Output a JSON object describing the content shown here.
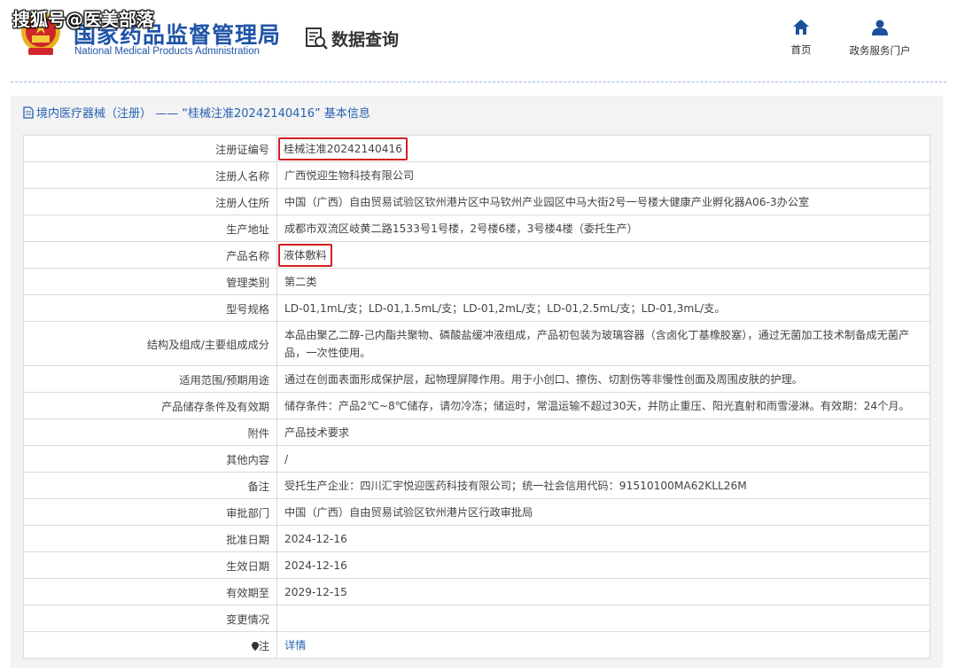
{
  "watermark": "搜狐号@医美部落",
  "header": {
    "org_name_cn": "国家药品监督管理局",
    "org_name_en": "National Medical Products Administration",
    "query_label": "数据查询",
    "nav": {
      "home_label": "首页",
      "gov_portal_label": "政务服务门户"
    }
  },
  "breadcrumb": {
    "text": "境内医疗器械（注册） —— “桂械注准20242140416” 基本信息"
  },
  "record": {
    "rows": [
      {
        "label": "注册证编号",
        "value": "桂械注准20242140416"
      },
      {
        "label": "注册人名称",
        "value": "广西悦迎生物科技有限公司"
      },
      {
        "label": "注册人住所",
        "value": "中国（广西）自由贸易试验区钦州港片区中马钦州产业园区中马大街2号一号楼大健康产业孵化器A06-3办公室"
      },
      {
        "label": "生产地址",
        "value": "成都市双流区岐黄二路1533号1号楼，2号楼6楼，3号楼4楼（委托生产）"
      },
      {
        "label": "产品名称",
        "value": "液体敷料"
      },
      {
        "label": "管理类别",
        "value": "第二类"
      },
      {
        "label": "型号规格",
        "value": "LD-01,1mL/支；LD-01,1.5mL/支；LD-01,2mL/支；LD-01,2.5mL/支；LD-01,3mL/支。"
      },
      {
        "label": "结构及组成/主要组成成分",
        "value": "本品由聚乙二醇-己内酯共聚物、磷酸盐缓冲液组成，产品初包装为玻璃容器（含卤化丁基橡胶塞），通过无菌加工技术制备成无菌产品，一次性使用。"
      },
      {
        "label": "适用范围/预期用途",
        "value": "通过在创面表面形成保护层，起物理屏障作用。用于小创口、擦伤、切割伤等非慢性创面及周围皮肤的护理。"
      },
      {
        "label": "产品储存条件及有效期",
        "value": "储存条件：产品2℃~8℃储存，请勿冷冻；储运时，常温运输不超过30天，并防止重压、阳光直射和雨雪浸淋。有效期：24个月。"
      },
      {
        "label": "附件",
        "value": "产品技术要求"
      },
      {
        "label": "其他内容",
        "value": "/"
      },
      {
        "label": "备注",
        "value": "受托生产企业：四川汇宇悦迎医药科技有限公司；统一社会信用代码：91510100MA62KLL26M"
      },
      {
        "label": "审批部门",
        "value": "中国（广西）自由贸易试验区钦州港片区行政审批局"
      },
      {
        "label": "批准日期",
        "value": "2024-12-16"
      },
      {
        "label": "生效日期",
        "value": "2024-12-16"
      },
      {
        "label": "有效期至",
        "value": "2029-12-15"
      },
      {
        "label": "变更情况",
        "value": ""
      },
      {
        "label": "注",
        "value": "详情"
      }
    ]
  },
  "colors": {
    "brand_blue": "#2054a8",
    "link_blue": "#2660b0",
    "highlight_red": "#d42020"
  }
}
